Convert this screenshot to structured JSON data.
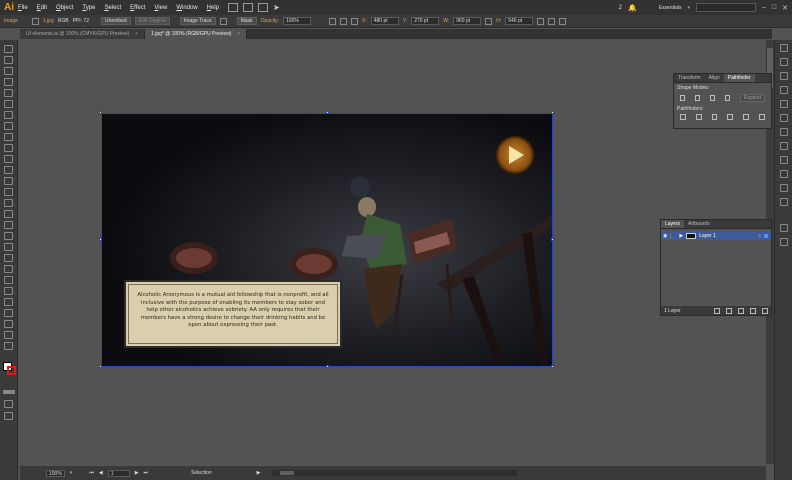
{
  "menubar": {
    "logo": "Ai",
    "items": [
      "File",
      "Edit",
      "Object",
      "Type",
      "Select",
      "Effect",
      "View",
      "Window",
      "Help"
    ],
    "notifications": "2",
    "workspace": "Essentials"
  },
  "control": {
    "type_label": "Image",
    "filename": "1.jpg",
    "color_mode": "RGB",
    "ppi": "PPI: 72",
    "embed_btn": "Unembed",
    "edit_original_btn": "Edit Original",
    "image_trace_btn": "Image Trace",
    "mask_btn": "Mask",
    "opacity_label": "Opacity:",
    "opacity_value": "100%",
    "x_label": "X:",
    "x_value": "480 pt",
    "y_label": "Y:",
    "y_value": "270 pt",
    "w_label": "W:",
    "w_value": "960 pt",
    "h_label": "H:",
    "h_value": "540 pt"
  },
  "tabs": [
    {
      "label": "UI elements.ai @ 100% (CMYK/GPU Preview)",
      "close": "×"
    },
    {
      "label": "1.jpg* @ 100% (RGB/GPU Preview)",
      "close": "×"
    }
  ],
  "artwork": {
    "caption": "Alcoholic Anonymous is a mutual aid fellowship that is nonprofit, and all inclusive with the purpose of enabling its members to stay sober and help other alcoholics achieve sobriety. AA only requires that their members have a strong desire to change their drinking habits and be open about expressing their past."
  },
  "pathfinder": {
    "tabs": [
      "Transform",
      "Align",
      "Pathfinder"
    ],
    "shape_modes": "Shape Modes:",
    "expand_btn": "Expand",
    "pathfinders": "Pathfinders:"
  },
  "layers": {
    "tabs": [
      "Layers",
      "Artboards"
    ],
    "layer_name": "Layer 1",
    "count": "1 Layer"
  },
  "status": {
    "zoom": "100%",
    "artboard": "1",
    "tool": "Selection"
  },
  "colors": {
    "brand": "#ff9a00",
    "selection": "#2c45b8",
    "caption_bg": "#d9cfae"
  }
}
